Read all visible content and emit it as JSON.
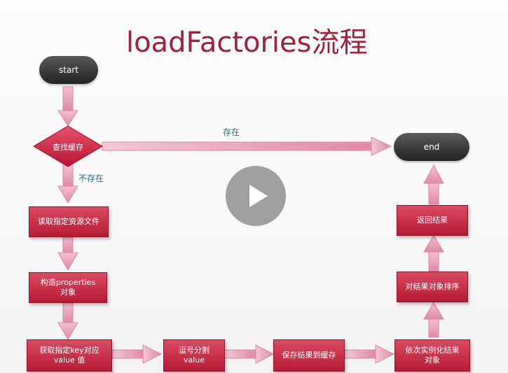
{
  "title": "loadFactories流程",
  "nodes": {
    "start": "start",
    "end": "end",
    "check_cache": "查找缓存",
    "read_file": "读取指定资源文件",
    "build_properties": "构造properties\n对象",
    "get_value": "获取指定key对应\nvalue 值",
    "split": "逗号分割\nvalue",
    "save_cache": "保存结果到缓存",
    "instantiate": "依次实例化结果\n对象",
    "sort": "对结果对象排序",
    "return": "返回结果"
  },
  "edge_labels": {
    "exists": "存在",
    "not_exists": "不存在"
  },
  "colors": {
    "title": "#a1203b",
    "box": "#c42a43",
    "arrow": "#e8a0b7",
    "label": "#2e6b7e"
  }
}
